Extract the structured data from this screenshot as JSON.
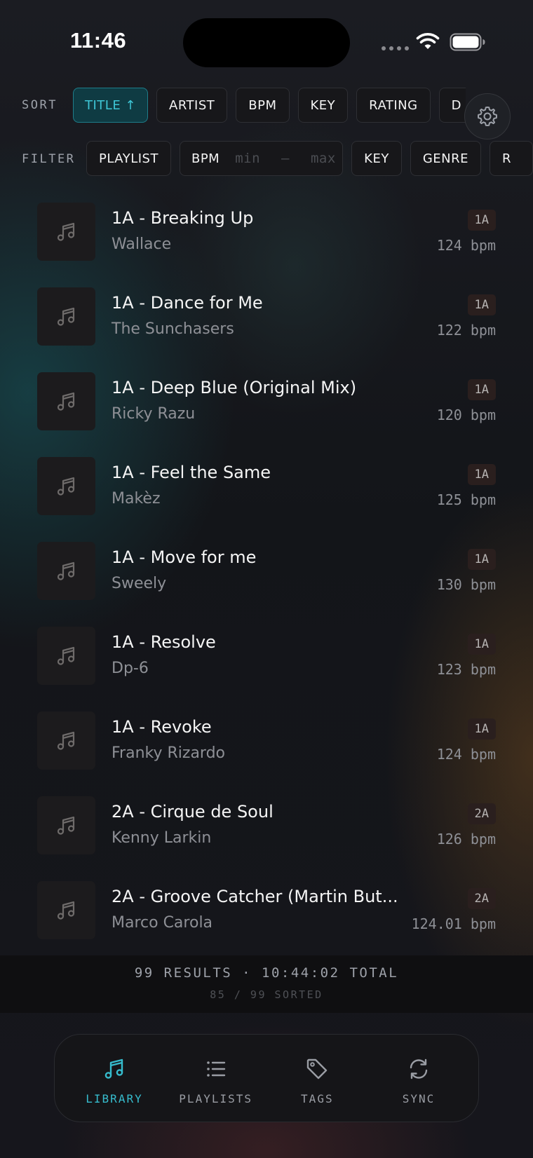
{
  "status_bar": {
    "time": "11:46",
    "icons": [
      "cellular-dots-icon",
      "wifi-icon",
      "battery-icon"
    ]
  },
  "sort": {
    "label": "SORT",
    "options": [
      {
        "label": "TITLE ↑",
        "active": true
      },
      {
        "label": "ARTIST",
        "active": false
      },
      {
        "label": "BPM",
        "active": false
      },
      {
        "label": "KEY",
        "active": false
      },
      {
        "label": "RATING",
        "active": false
      },
      {
        "label": "D",
        "active": false
      }
    ]
  },
  "settings_icon": "gear-icon",
  "filter": {
    "label": "FILTER",
    "playlist_label": "PLAYLIST",
    "bpm_label": "BPM",
    "bpm_min_placeholder": "min",
    "bpm_separator": "–",
    "bpm_max_placeholder": "max",
    "key_label": "KEY",
    "genre_label": "GENRE",
    "more_label": "R"
  },
  "tracks": [
    {
      "title": "1A - Breaking Up",
      "artist": "Wallace",
      "key": "1A",
      "bpm": "124 bpm"
    },
    {
      "title": "1A - Dance for Me",
      "artist": "The Sunchasers",
      "key": "1A",
      "bpm": "122 bpm"
    },
    {
      "title": "1A - Deep Blue (Original Mix)",
      "artist": "Ricky Razu",
      "key": "1A",
      "bpm": "120 bpm"
    },
    {
      "title": "1A - Feel the Same",
      "artist": "Makèz",
      "key": "1A",
      "bpm": "125 bpm"
    },
    {
      "title": "1A - Move for me",
      "artist": "Sweely",
      "key": "1A",
      "bpm": "130 bpm"
    },
    {
      "title": "1A - Resolve",
      "artist": "Dp-6",
      "key": "1A",
      "bpm": "123 bpm"
    },
    {
      "title": "1A - Revoke",
      "artist": "Franky Rizardo",
      "key": "1A",
      "bpm": "124 bpm"
    },
    {
      "title": "2A - Cirque de Soul",
      "artist": "Kenny Larkin",
      "key": "2A",
      "bpm": "126 bpm"
    },
    {
      "title": "2A - Groove Catcher (Martin But...",
      "artist": "Marco Carola",
      "key": "2A",
      "bpm": "124.01 bpm"
    }
  ],
  "results": {
    "summary": "99 RESULTS · 10:44:02 TOTAL",
    "sorted": "85 / 99 SORTED"
  },
  "tabs": [
    {
      "label": "LIBRARY",
      "icon": "music-note-icon",
      "active": true
    },
    {
      "label": "PLAYLISTS",
      "icon": "list-icon",
      "active": false
    },
    {
      "label": "TAGS",
      "icon": "tag-icon",
      "active": false
    },
    {
      "label": "SYNC",
      "icon": "sync-icon",
      "active": false
    }
  ],
  "colors": {
    "accent": "#3ec6d6",
    "active_chip_bg": "#0f3b43",
    "background": "#15161c"
  }
}
